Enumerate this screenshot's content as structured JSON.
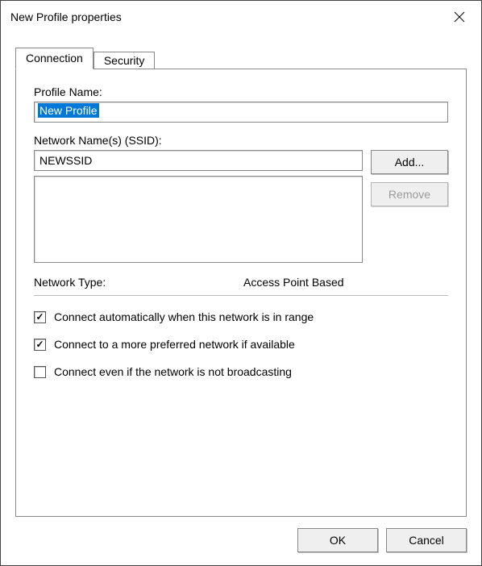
{
  "window": {
    "title": "New Profile properties"
  },
  "tabs": {
    "connection": "Connection",
    "security": "Security"
  },
  "profile": {
    "label": "Profile Name:",
    "value": "New Profile"
  },
  "ssid": {
    "label": "Network Name(s) (SSID):",
    "value": "NEWSSID"
  },
  "buttons": {
    "add": "Add...",
    "remove": "Remove",
    "ok": "OK",
    "cancel": "Cancel"
  },
  "network_type": {
    "label": "Network Type:",
    "value": "Access Point Based"
  },
  "checks": {
    "auto_connect": "Connect automatically when this network is in range",
    "more_preferred": "Connect to a more preferred network if available",
    "not_broadcasting": "Connect even if the network is not broadcasting"
  },
  "check_states": {
    "auto_connect": true,
    "more_preferred": true,
    "not_broadcasting": false
  }
}
